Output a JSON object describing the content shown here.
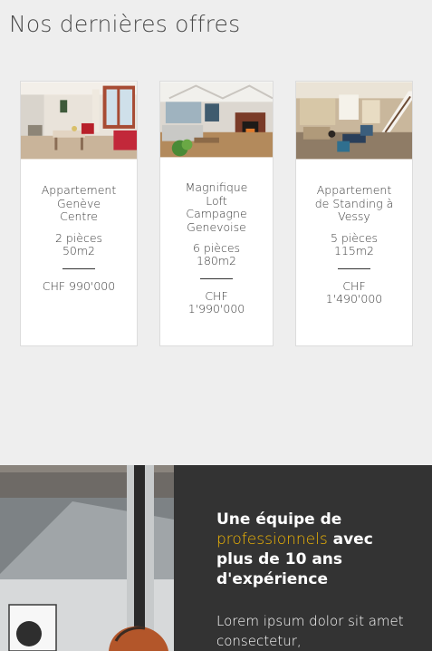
{
  "offers": {
    "title": "Nos dernières offres",
    "items": [
      {
        "name": "Appartement Genève Centre",
        "rooms": "2 pièces",
        "area": "50m2",
        "price": "CHF 990'000"
      },
      {
        "name": "Magnifique Loft Campagne Genevoise",
        "rooms": "6 pièces",
        "area": "180m2",
        "price": "CHF 1'990'000"
      },
      {
        "name": "Appartement de Standing à Vessy",
        "rooms": "5 pièces",
        "area": "115m2",
        "price": "CHF 1'490'000"
      }
    ]
  },
  "team": {
    "heading_part1": "Une équipe de",
    "heading_accent": "professionnels",
    "heading_part2": "avec plus de 10 ans d'expérience",
    "body": "Lorem ipsum dolor sit amet consectetur,"
  },
  "colors": {
    "accent": "#f2b705",
    "panel": "#333333",
    "background": "#eeeeee"
  }
}
